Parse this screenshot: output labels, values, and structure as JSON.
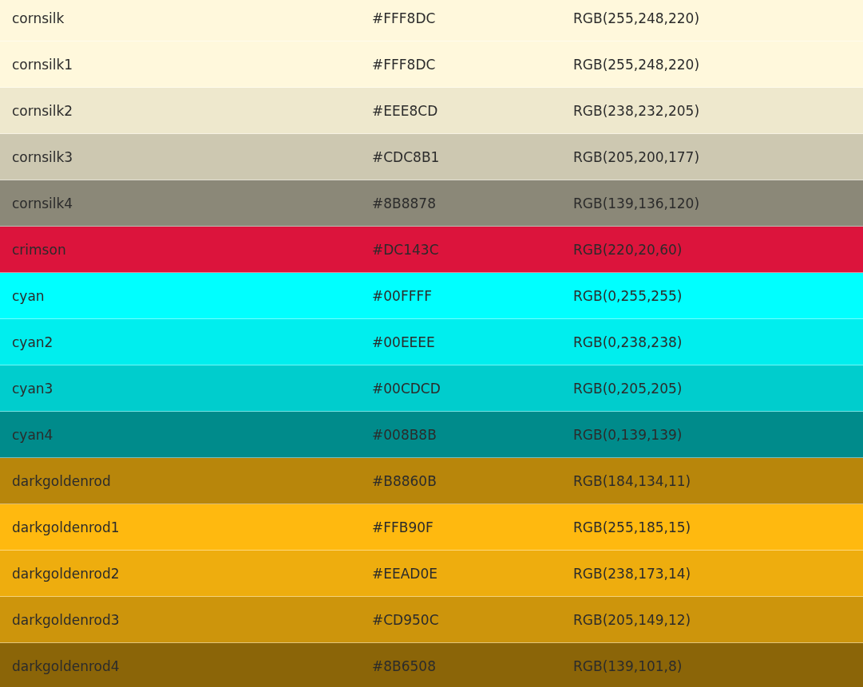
{
  "table": {
    "rows": [
      {
        "name": "cornsilk",
        "hex": "#FFF8DC",
        "rgb": "RGB(255,248,220)",
        "color": "#fff8dc"
      },
      {
        "name": "cornsilk1",
        "hex": "#FFF8DC",
        "rgb": "RGB(255,248,220)",
        "color": "#fff8dc"
      },
      {
        "name": "cornsilk2",
        "hex": "#EEE8CD",
        "rgb": "RGB(238,232,205)",
        "color": "#eee8cd"
      },
      {
        "name": "cornsilk3",
        "hex": "#CDC8B1",
        "rgb": "RGB(205,200,177)",
        "color": "#cdc8b1"
      },
      {
        "name": "cornsilk4",
        "hex": "#8B8878",
        "rgb": "RGB(139,136,120)",
        "color": "#8b8878"
      },
      {
        "name": "crimson",
        "hex": "#DC143C",
        "rgb": "RGB(220,20,60)",
        "color": "#dc143c"
      },
      {
        "name": "cyan",
        "hex": "#00FFFF",
        "rgb": "RGB(0,255,255)",
        "color": "#00ffff"
      },
      {
        "name": "cyan2",
        "hex": "#00EEEE",
        "rgb": "RGB(0,238,238)",
        "color": "#00eeee"
      },
      {
        "name": "cyan3",
        "hex": "#00CDCD",
        "rgb": "RGB(0,205,205)",
        "color": "#00cdcd"
      },
      {
        "name": "cyan4",
        "hex": "#008B8B",
        "rgb": "RGB(0,139,139)",
        "color": "#008b8b"
      },
      {
        "name": "darkgoldenrod",
        "hex": "#B8860B",
        "rgb": "RGB(184,134,11)",
        "color": "#b8860b"
      },
      {
        "name": "darkgoldenrod1",
        "hex": "#FFB90F",
        "rgb": "RGB(255,185,15)",
        "color": "#ffb90f"
      },
      {
        "name": "darkgoldenrod2",
        "hex": "#EEAD0E",
        "rgb": "RGB(238,173,14)",
        "color": "#eead0e"
      },
      {
        "name": "darkgoldenrod3",
        "hex": "#CD950C",
        "rgb": "RGB(205,149,12)",
        "color": "#cd950c"
      },
      {
        "name": "darkgoldenrod4",
        "hex": "#8B6508",
        "rgb": "RGB(139,101,8)",
        "color": "#8b6508"
      }
    ]
  }
}
